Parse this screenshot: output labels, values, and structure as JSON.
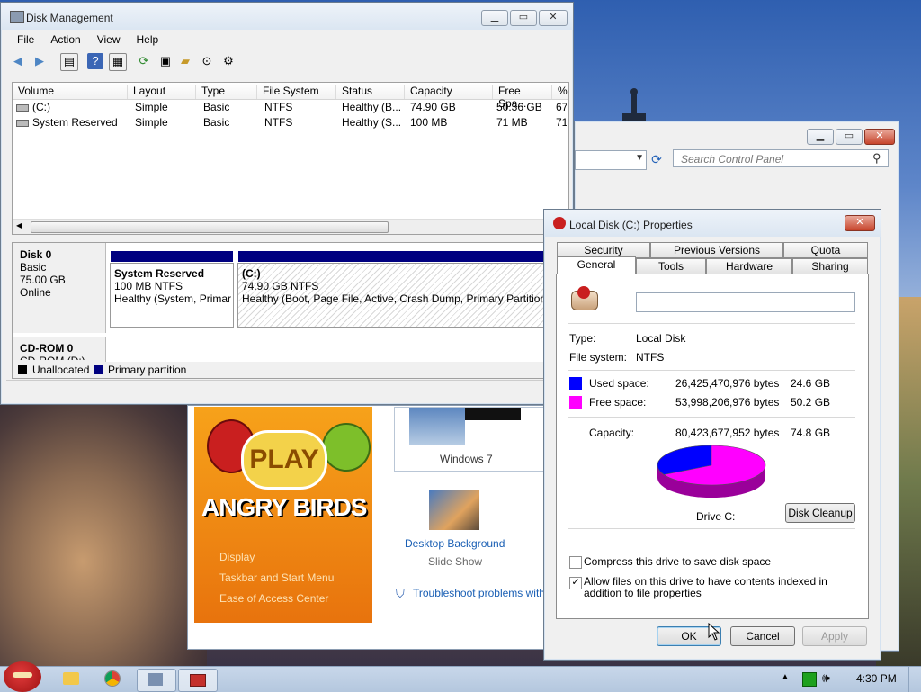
{
  "disk_mgmt": {
    "title": "Disk Management",
    "menu": [
      "File",
      "Action",
      "View",
      "Help"
    ],
    "columns": [
      "Volume",
      "Layout",
      "Type",
      "File System",
      "Status",
      "Capacity",
      "Free Spa...",
      "%"
    ],
    "rows": [
      [
        "(C:)",
        "Simple",
        "Basic",
        "NTFS",
        "Healthy (B...",
        "74.90 GB",
        "50.36 GB",
        "67"
      ],
      [
        "System Reserved",
        "Simple",
        "Basic",
        "NTFS",
        "Healthy (S...",
        "100 MB",
        "71 MB",
        "71"
      ]
    ],
    "disk0": {
      "name": "Disk 0",
      "type": "Basic",
      "size": "75.00 GB",
      "status": "Online"
    },
    "part_reserved": {
      "name": "System Reserved",
      "size": "100 MB NTFS",
      "status": "Healthy (System, Primar"
    },
    "part_c": {
      "name": "(C:)",
      "size": "74.90 GB NTFS",
      "status": "Healthy (Boot, Page File, Active, Crash Dump, Primary Partition"
    },
    "cdrom": {
      "name": "CD-ROM 0",
      "sub": "CD-ROM (D:)"
    },
    "legend": {
      "unallocated": "Unallocated",
      "primary": "Primary partition"
    }
  },
  "control_panel": {
    "search_placeholder": "Search Control Panel",
    "windows7": "Windows 7",
    "desktop_bg": "Desktop Background",
    "slide_show": "Slide Show",
    "troubleshoot": "Troubleshoot problems with",
    "play": "PLAY",
    "angry_birds": "ANGRY BIRDS",
    "links": [
      "Display",
      "Taskbar and Start Menu",
      "Ease of Access Center"
    ]
  },
  "props": {
    "title": "Local Disk (C:) Properties",
    "tabs_back": [
      "Security",
      "Previous Versions",
      "Quota"
    ],
    "tabs_front": [
      "General",
      "Tools",
      "Hardware",
      "Sharing"
    ],
    "name_value": "",
    "type_label": "Type:",
    "type_value": "Local Disk",
    "fs_label": "File system:",
    "fs_value": "NTFS",
    "used_label": "Used space:",
    "used_bytes": "26,425,470,976 bytes",
    "used_gb": "24.6 GB",
    "free_label": "Free space:",
    "free_bytes": "53,998,206,976 bytes",
    "free_gb": "50.2 GB",
    "cap_label": "Capacity:",
    "cap_bytes": "80,423,677,952 bytes",
    "cap_gb": "74.8 GB",
    "drive_label": "Drive C:",
    "disk_cleanup": "Disk Cleanup",
    "compress": "Compress this drive to save disk space",
    "index": "Allow files on this drive to have contents indexed in addition to file properties",
    "ok": "OK",
    "cancel": "Cancel",
    "apply": "Apply",
    "used_fraction": 0.329,
    "used_color": "#0000ff",
    "free_color": "#ff00ff"
  },
  "taskbar": {
    "time": "4:30 PM"
  }
}
